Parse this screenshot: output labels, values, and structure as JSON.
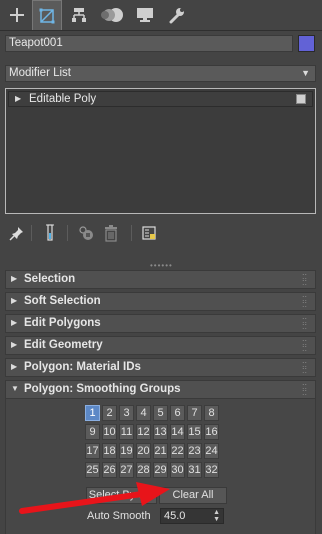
{
  "tabs": [
    {
      "name": "create-tab",
      "icon": "plus-icon"
    },
    {
      "name": "modify-tab",
      "icon": "modify-icon",
      "active": true
    },
    {
      "name": "hierarchy-tab",
      "icon": "hierarchy-icon"
    },
    {
      "name": "motion-tab",
      "icon": "motion-icon"
    },
    {
      "name": "display-tab",
      "icon": "display-icon"
    },
    {
      "name": "utilities-tab",
      "icon": "wrench-icon"
    }
  ],
  "object": {
    "name": "Teapot001",
    "color": "#6262d6"
  },
  "modifier_list": {
    "label": "Modifier List"
  },
  "stack": {
    "items": [
      {
        "label": "Editable Poly"
      }
    ]
  },
  "stack_toolbar": [
    "pin-stack-icon",
    "show-end-result-icon",
    "make-unique-icon",
    "remove-modifier-icon",
    "configure-modifier-sets-icon"
  ],
  "rollouts": {
    "selection": "Selection",
    "soft_selection": "Soft Selection",
    "edit_polygons": "Edit Polygons",
    "edit_geometry": "Edit Geometry",
    "material_ids": "Polygon: Material IDs",
    "smoothing_groups": "Polygon: Smoothing Groups"
  },
  "smoothing_groups": {
    "buttons": [
      "1",
      "2",
      "3",
      "4",
      "5",
      "6",
      "7",
      "8",
      "9",
      "10",
      "11",
      "12",
      "13",
      "14",
      "15",
      "16",
      "17",
      "18",
      "19",
      "20",
      "21",
      "22",
      "23",
      "24",
      "25",
      "26",
      "27",
      "28",
      "29",
      "30",
      "31",
      "32"
    ],
    "active": [
      "1"
    ],
    "select_by_sg": "Select By SG",
    "clear_all": "Clear All",
    "auto_smooth_label": "Auto Smooth",
    "auto_smooth_value": "45.0"
  },
  "colors": {
    "accent": "#5c88c6",
    "annotation_arrow": "#e8141a"
  }
}
